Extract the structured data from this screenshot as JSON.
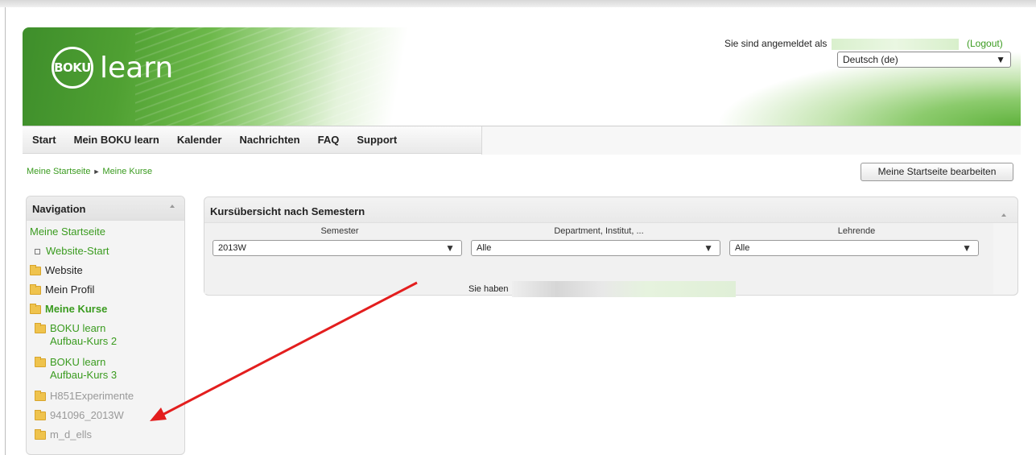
{
  "header": {
    "logo_abbrev": "BOKU",
    "logo_text": "learn",
    "login_prefix": "Sie sind angemeldet als",
    "logout_label": "(Logout)",
    "language": "Deutsch (de)"
  },
  "navbar": {
    "items": [
      "Start",
      "Mein BOKU learn",
      "Kalender",
      "Nachrichten",
      "FAQ",
      "Support"
    ]
  },
  "breadcrumb": {
    "items": [
      "Meine Startseite",
      "Meine Kurse"
    ],
    "separator": "►"
  },
  "edit_button_label": "Meine Startseite bearbeiten",
  "navigation": {
    "title": "Navigation",
    "home": "Meine Startseite",
    "site_home": "Website-Start",
    "website": "Website",
    "profile": "Mein Profil",
    "my_courses": "Meine Kurse",
    "courses": [
      "BOKU learn Aufbau-Kurs 2",
      "BOKU learn Aufbau-Kurs 3",
      "H851Experimente",
      "941096_2013W",
      "m_d_ells"
    ]
  },
  "course_overview": {
    "title": "Kursübersicht nach Semestern",
    "filters": [
      {
        "label": "Semester",
        "value": "2013W"
      },
      {
        "label": "Department, Institut, ...",
        "value": "Alle"
      },
      {
        "label": "Lehrende",
        "value": "Alle"
      }
    ],
    "info_text": "Sie haben"
  },
  "colors": {
    "accent_green": "#3a9b1f",
    "annotation_arrow": "#e31e1e"
  }
}
